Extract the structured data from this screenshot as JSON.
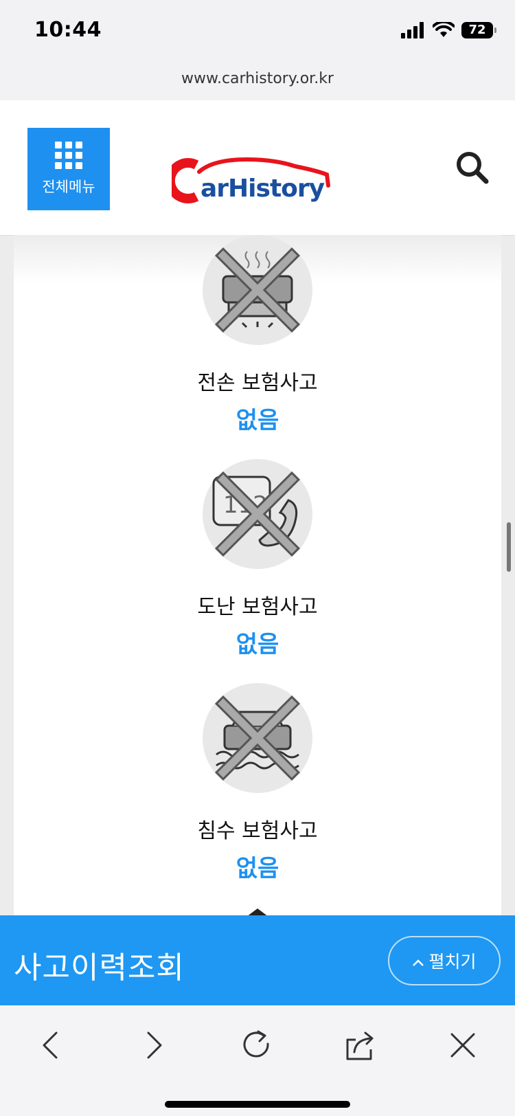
{
  "status": {
    "time": "10:44",
    "battery": "72"
  },
  "browser": {
    "url": "www.carhistory.or.kr"
  },
  "header": {
    "menu_label": "전체메뉴",
    "logo_text": "CarHistory"
  },
  "items": [
    {
      "title": "전손 보험사고",
      "value": "없음",
      "icon": "car-total-loss-icon"
    },
    {
      "title": "도난 보험사고",
      "value": "없음",
      "icon": "car-theft-phone-icon"
    },
    {
      "title": "침수 보험사고",
      "value": "없음",
      "icon": "car-flood-icon"
    }
  ],
  "bottom": {
    "title": "사고이력조회",
    "expand_label": "펼치기"
  },
  "colors": {
    "accent": "#1e90f0",
    "bar": "#1e98f2"
  }
}
